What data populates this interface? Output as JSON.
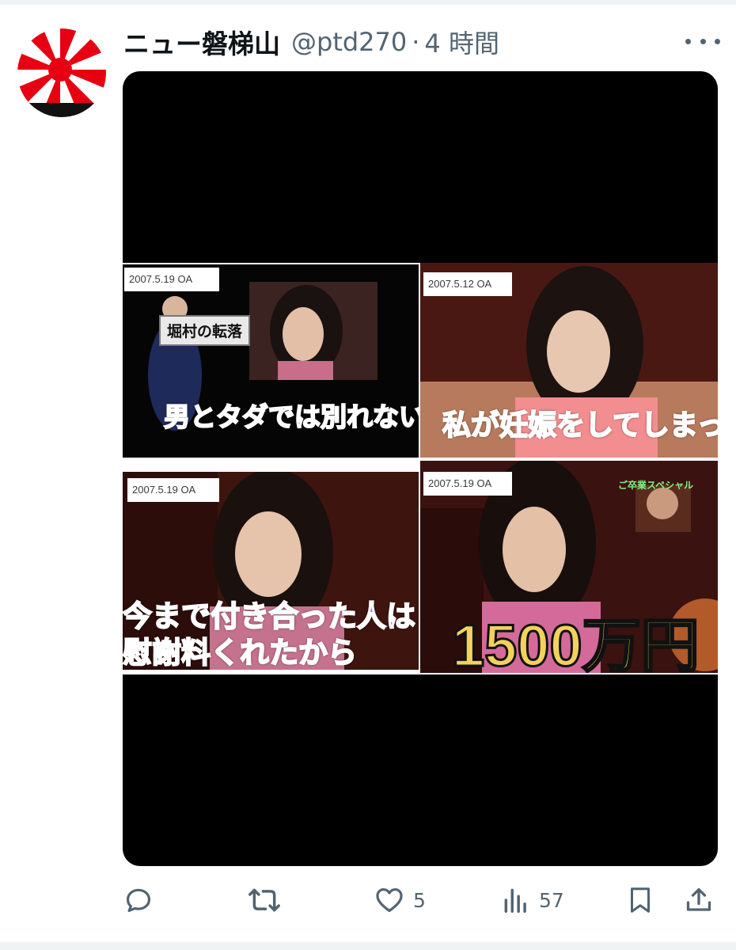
{
  "tweet": {
    "display_name": "ニュー磐梯山",
    "handle": "@ptd270",
    "separator": "·",
    "time": "4 時間"
  },
  "media": {
    "panels": [
      {
        "date": "2007.5.19 OA",
        "tag": "堀村の転落",
        "caption": "男とタダでは別れない"
      },
      {
        "date": "2007.5.12 OA",
        "caption": "私が妊娠をしてしまったと"
      },
      {
        "date": "2007.5.19 OA",
        "caption_line1": "今まで付き合った人は",
        "caption_line2": "慰謝料くれたから"
      },
      {
        "date": "2007.5.19 OA",
        "special": "ご卒業スペシャル",
        "caption": "1500万円"
      }
    ]
  },
  "actions": {
    "reply_count": "",
    "retweet_count": "",
    "like_count": "5",
    "views_count": "57"
  },
  "colors": {
    "text_primary": "#0f1419",
    "text_secondary": "#536471",
    "flag_red": "#e60012",
    "caption_pink": "#e040e0",
    "caption_gold": "#f2d25a"
  },
  "icons": [
    "rising-sun-flag-avatar",
    "more-icon",
    "reply-icon",
    "retweet-icon",
    "like-icon",
    "views-icon",
    "bookmark-icon",
    "share-icon"
  ]
}
